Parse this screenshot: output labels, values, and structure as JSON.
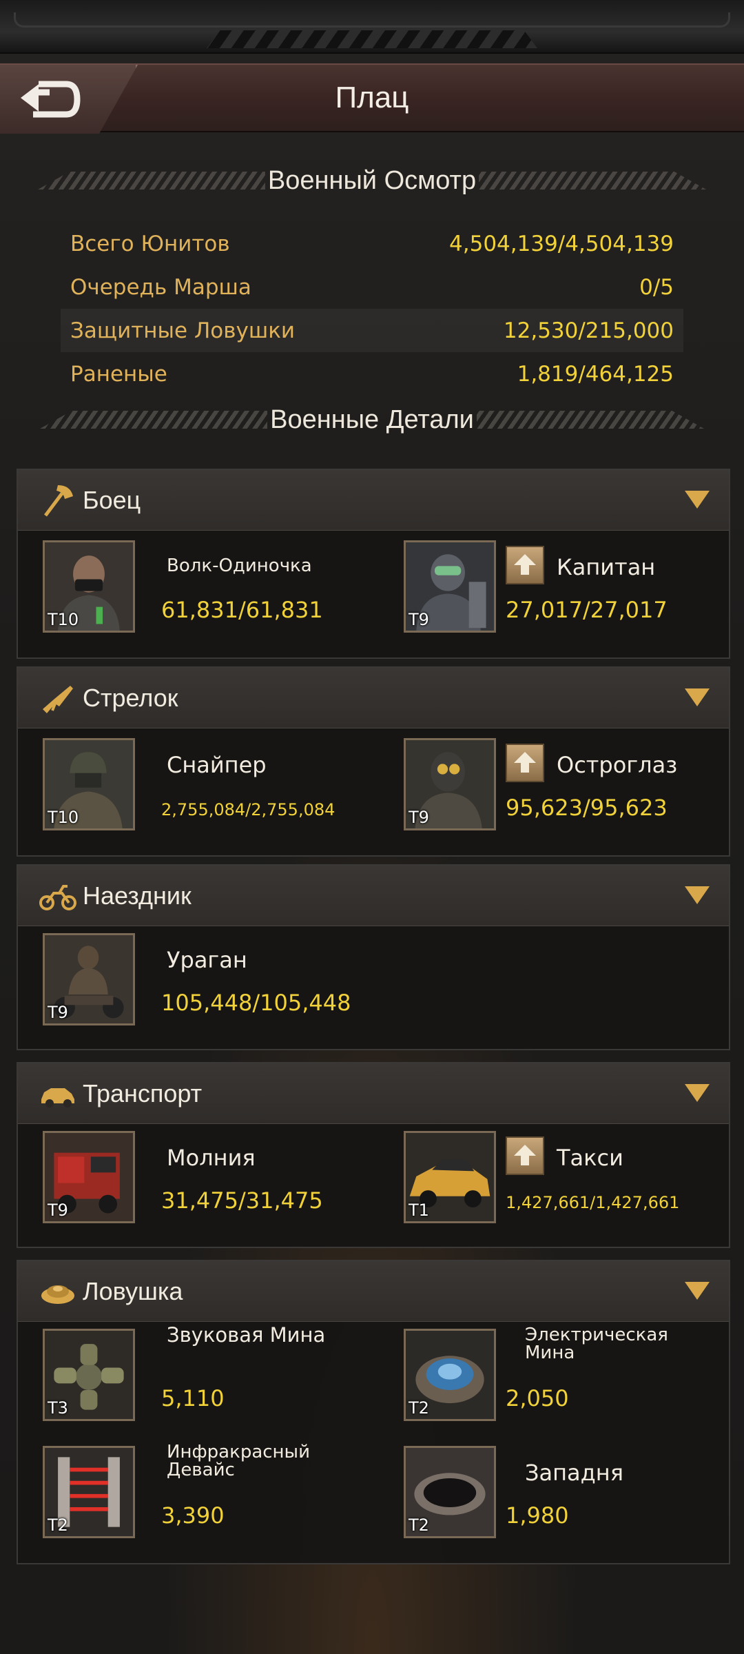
{
  "header": {
    "title": "Плац"
  },
  "overview": {
    "heading": "Военный Осмотр",
    "rows": [
      {
        "label": "Всего Юнитов",
        "value": "4,504,139/4,504,139"
      },
      {
        "label": "Очередь Марша",
        "value": "0/5"
      },
      {
        "label": "Защитные Ловушки",
        "value": "12,530/215,000"
      },
      {
        "label": "Раненые",
        "value": "1,819/464,125"
      }
    ]
  },
  "details": {
    "heading": "Военные Детали"
  },
  "categories": [
    {
      "name": "Боец",
      "icon": "axe-icon",
      "units": [
        {
          "name": "Волк-Одиночка",
          "tier": "T10",
          "count": "61,831/61,831",
          "upgrade": false
        },
        {
          "name": "Капитан",
          "tier": "T9",
          "count": "27,017/27,017",
          "upgrade": true
        }
      ]
    },
    {
      "name": "Стрелок",
      "icon": "rifle-icon",
      "units": [
        {
          "name": "Снайпер",
          "tier": "T10",
          "count": "2,755,084/2,755,084",
          "upgrade": false
        },
        {
          "name": "Остроглаз",
          "tier": "T9",
          "count": "95,623/95,623",
          "upgrade": true
        }
      ]
    },
    {
      "name": "Наездник",
      "icon": "motorcycle-icon",
      "units": [
        {
          "name": "Ураган",
          "tier": "T9",
          "count": "105,448/105,448",
          "upgrade": false
        }
      ]
    },
    {
      "name": "Транспорт",
      "icon": "car-icon",
      "units": [
        {
          "name": "Молния",
          "tier": "T9",
          "count": "31,475/31,475",
          "upgrade": false
        },
        {
          "name": "Такси",
          "tier": "T1",
          "count": "1,427,661/1,427,661",
          "upgrade": true
        }
      ]
    },
    {
      "name": "Ловушка",
      "icon": "mine-icon",
      "units": [
        {
          "name": "Звуковая Мина",
          "tier": "T3",
          "count": "5,110",
          "upgrade": false
        },
        {
          "name": "Электрическая Мина",
          "tier": "T2",
          "count": "2,050",
          "upgrade": false
        },
        {
          "name": "Инфракрасный Девайс",
          "tier": "T2",
          "count": "3,390",
          "upgrade": false
        },
        {
          "name": "Западня",
          "tier": "T2",
          "count": "1,980",
          "upgrade": false
        }
      ]
    }
  ],
  "colors": {
    "label": "#e0b25a",
    "value": "#f2d23a",
    "accent": "#d9a84a"
  }
}
